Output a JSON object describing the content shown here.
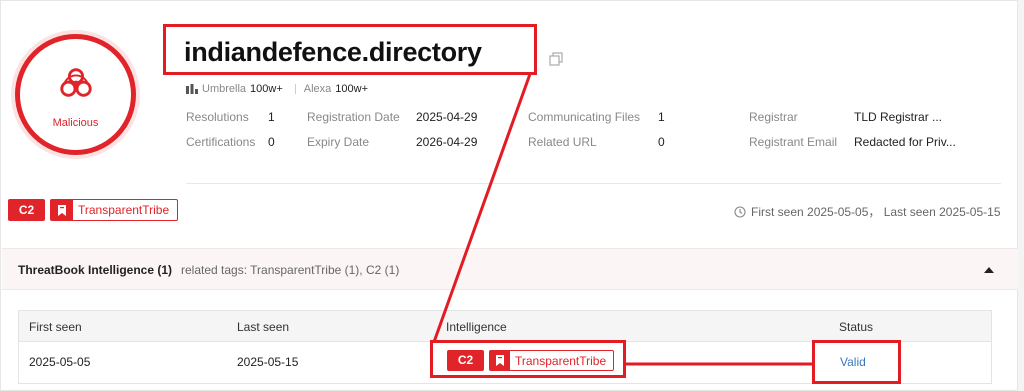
{
  "badge": {
    "label": "Malicious",
    "icon": "biohazard-icon",
    "color": "#e02429"
  },
  "domain": {
    "title": "indiandefence.directory",
    "copy_icon": "copy-icon"
  },
  "rank": {
    "umbrella_label": "Umbrella",
    "umbrella_value": "100w+",
    "alexa_label": "Alexa",
    "alexa_value": "100w+"
  },
  "info": {
    "resolutions_label": "Resolutions",
    "resolutions_value": "1",
    "certifications_label": "Certifications",
    "certifications_value": "0",
    "registration_date_label": "Registration Date",
    "registration_date_value": "2025-04-29",
    "expiry_date_label": "Expiry Date",
    "expiry_date_value": "2026-04-29",
    "communicating_files_label": "Communicating Files",
    "communicating_files_value": "1",
    "related_url_label": "Related URL",
    "related_url_value": "0",
    "registrar_label": "Registrar",
    "registrar_value": "TLD Registrar ...",
    "registrant_email_label": "Registrant Email",
    "registrant_email_value": "Redacted for Priv..."
  },
  "tags": {
    "c2": "C2",
    "tribe": "TransparentTribe"
  },
  "seen": {
    "text": "First seen 2025-05-05， Last seen 2025-05-15"
  },
  "section": {
    "title": "ThreatBook Intelligence",
    "count": "(1)",
    "related": "related tags: TransparentTribe (1), C2 (1)"
  },
  "table": {
    "headers": [
      "First seen",
      "Last seen",
      "Intelligence",
      "Status"
    ],
    "rows": [
      {
        "first_seen": "2025-05-05",
        "last_seen": "2025-05-15",
        "tag_c2": "C2",
        "tag_tribe": "TransparentTribe",
        "status": "Valid"
      }
    ]
  },
  "colors": {
    "accent": "#e02429",
    "link": "#3a78c3",
    "annotation": "#e31b23"
  }
}
